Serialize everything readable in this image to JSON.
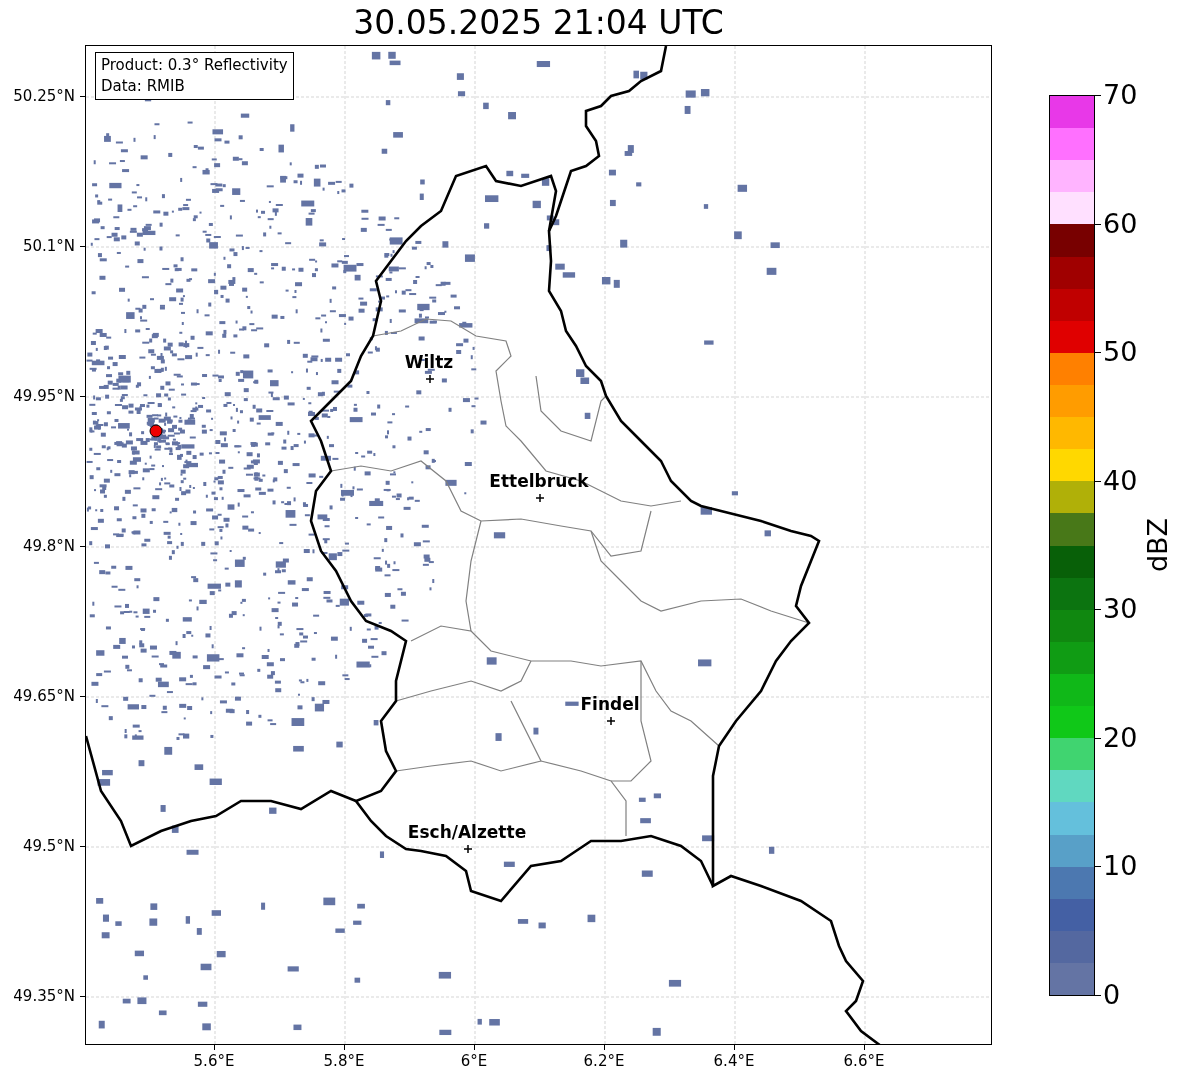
{
  "title": "30.05.2025 21:04 UTC",
  "legend": [
    "Product: 0.3° Reflectivity",
    "Data: RMIB"
  ],
  "yticks": [
    "50.25°N",
    "50.1°N",
    "49.95°N",
    "49.8°N",
    "49.65°N",
    "49.5°N",
    "49.35°N"
  ],
  "xticks": [
    "5.6°E",
    "5.8°E",
    "6°E",
    "6.2°E",
    "6.4°E",
    "6.6°E"
  ],
  "cities": [
    {
      "name": "Wiltz"
    },
    {
      "name": "Ettelbruck"
    },
    {
      "name": "Findel"
    },
    {
      "name": "Esch/Alzette"
    }
  ],
  "colorbar": {
    "label": "dBZ",
    "ticks": [
      "70",
      "60",
      "50",
      "40",
      "30",
      "20",
      "10",
      "0"
    ],
    "bins": [
      {
        "color": "#e838e8"
      },
      {
        "color": "#ff70ff"
      },
      {
        "color": "#ffb4ff"
      },
      {
        "color": "#ffe0ff"
      },
      {
        "color": "#780000"
      },
      {
        "color": "#a00000"
      },
      {
        "color": "#c00000"
      },
      {
        "color": "#e00000"
      },
      {
        "color": "#ff8000"
      },
      {
        "color": "#ff9c00"
      },
      {
        "color": "#ffb800"
      },
      {
        "color": "#ffd800"
      },
      {
        "color": "#b0b008"
      },
      {
        "color": "#487818"
      },
      {
        "color": "#086008"
      },
      {
        "color": "#0c7410"
      },
      {
        "color": "#108810"
      },
      {
        "color": "#109c14"
      },
      {
        "color": "#10b818"
      },
      {
        "color": "#10c818"
      },
      {
        "color": "#40d470"
      },
      {
        "color": "#60d8c0"
      },
      {
        "color": "#64c0dc"
      },
      {
        "color": "#58a0c8"
      },
      {
        "color": "#4c78b0"
      },
      {
        "color": "#4460a4"
      },
      {
        "color": "#5468a0"
      },
      {
        "color": "#6474a4"
      }
    ]
  }
}
